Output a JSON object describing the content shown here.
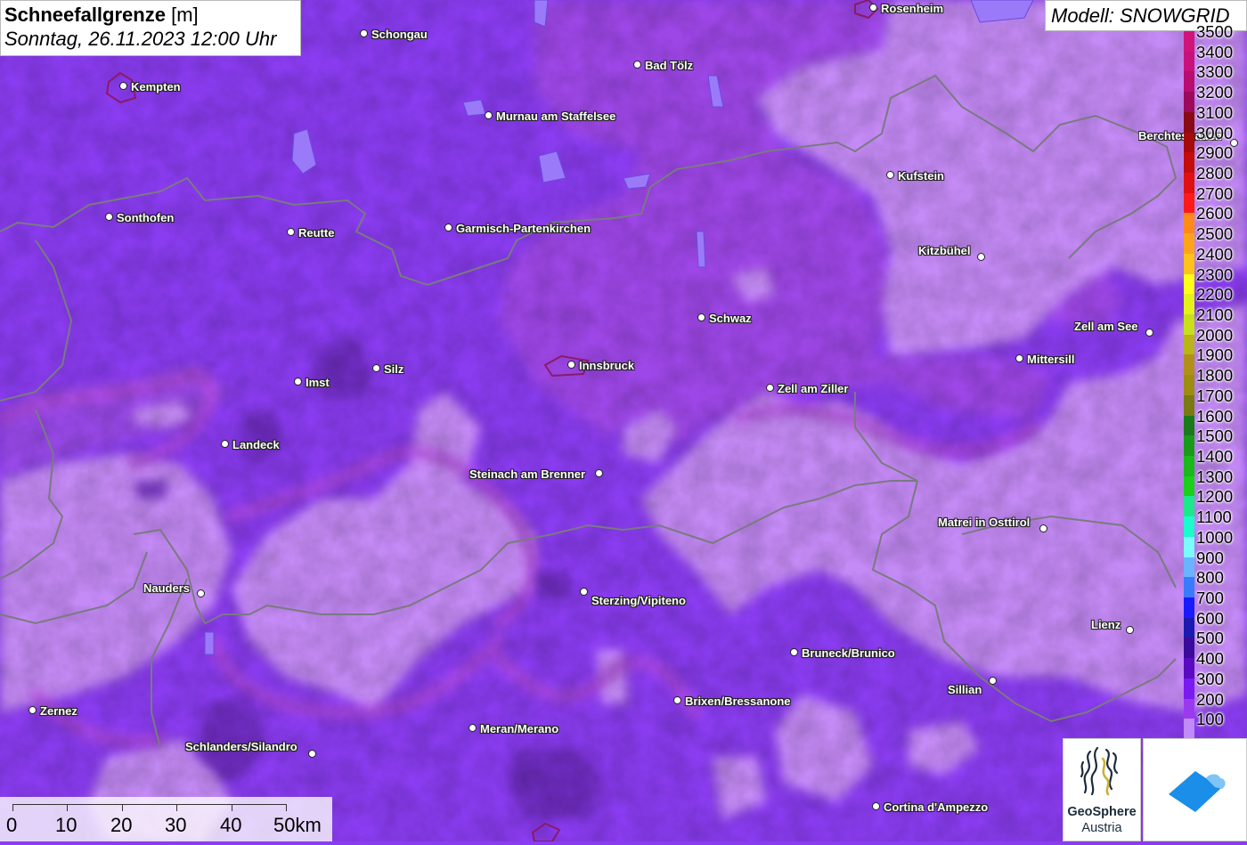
{
  "title": {
    "variable": "Schneefallgrenze",
    "unit": "[m]",
    "datetime": "Sonntag, 26.11.2023 12:00 Uhr"
  },
  "model": {
    "label": "Modell: SNOWGRID"
  },
  "legend": {
    "items": [
      {
        "label": "3500",
        "color": "#d1147a"
      },
      {
        "label": "3400",
        "color": "#c8117a"
      },
      {
        "label": "3300",
        "color": "#b80c6e"
      },
      {
        "label": "3200",
        "color": "#9c0a5c"
      },
      {
        "label": "3100",
        "color": "#8a0a14"
      },
      {
        "label": "3000",
        "color": "#a60a0a"
      },
      {
        "label": "2900",
        "color": "#c40c0c"
      },
      {
        "label": "2800",
        "color": "#e01010"
      },
      {
        "label": "2700",
        "color": "#ff1a1a"
      },
      {
        "label": "2600",
        "color": "#ff8a1a"
      },
      {
        "label": "2500",
        "color": "#ffa41a"
      },
      {
        "label": "2400",
        "color": "#ffc21a"
      },
      {
        "label": "2300",
        "color": "#ffff1a"
      },
      {
        "label": "2200",
        "color": "#e4f21a"
      },
      {
        "label": "2100",
        "color": "#c8e01a"
      },
      {
        "label": "2000",
        "color": "#b8b41a"
      },
      {
        "label": "1900",
        "color": "#b0901a"
      },
      {
        "label": "1800",
        "color": "#9c8c12"
      },
      {
        "label": "1700",
        "color": "#7a7a12"
      },
      {
        "label": "1600",
        "color": "#1a7a1a"
      },
      {
        "label": "1500",
        "color": "#1a9a1a"
      },
      {
        "label": "1400",
        "color": "#1ab81a"
      },
      {
        "label": "1300",
        "color": "#1ad01a"
      },
      {
        "label": "1200",
        "color": "#1ae88a"
      },
      {
        "label": "1100",
        "color": "#1afccc"
      },
      {
        "label": "1000",
        "color": "#7afcfc"
      },
      {
        "label": "900",
        "color": "#6ab4ff"
      },
      {
        "label": "800",
        "color": "#3a7aff"
      },
      {
        "label": "700",
        "color": "#1a1aff"
      },
      {
        "label": "600",
        "color": "#1a1ab0"
      },
      {
        "label": "500",
        "color": "#3a0a9a"
      },
      {
        "label": "400",
        "color": "#5a0ac0"
      },
      {
        "label": "300",
        "color": "#7a1af0"
      },
      {
        "label": "200",
        "color": "#9a3af0"
      },
      {
        "label": "100",
        "color": "#c08af8"
      }
    ]
  },
  "cities": [
    {
      "name": "Rosenheim"
    },
    {
      "name": "Schongau"
    },
    {
      "name": "Bad Tölz"
    },
    {
      "name": "Kempten"
    },
    {
      "name": "Murnau am Staffelsee"
    },
    {
      "name": "Berchtesgaden"
    },
    {
      "name": "Kufstein"
    },
    {
      "name": "Sonthofen"
    },
    {
      "name": "Reutte"
    },
    {
      "name": "Garmisch-Partenkirchen"
    },
    {
      "name": "Kitzbühel"
    },
    {
      "name": "Schwaz"
    },
    {
      "name": "Zell am See"
    },
    {
      "name": "Mittersill"
    },
    {
      "name": "Silz"
    },
    {
      "name": "Innsbruck"
    },
    {
      "name": "Imst"
    },
    {
      "name": "Zell am Ziller"
    },
    {
      "name": "Landeck"
    },
    {
      "name": "Steinach am Brenner"
    },
    {
      "name": "Matrei in Osttirol"
    },
    {
      "name": "Nauders"
    },
    {
      "name": "Sterzing/Vipiteno"
    },
    {
      "name": "Lienz"
    },
    {
      "name": "Bruneck/Brunico"
    },
    {
      "name": "Sillian"
    },
    {
      "name": "Brixen/Bressanone"
    },
    {
      "name": "Zernez"
    },
    {
      "name": "Meran/Merano"
    },
    {
      "name": "Schlanders/Silandro"
    },
    {
      "name": "Cortina d'Ampezzo"
    }
  ],
  "scale": {
    "labels": [
      "0",
      "10",
      "20",
      "30",
      "40",
      "50km"
    ]
  },
  "logos": {
    "geosphere_name": "GeoSphere",
    "geosphere_sub": "Austria"
  },
  "colors": {
    "light_lavender": "#c48af5",
    "purple": "#8a3cf0",
    "magenta_purple": "#a64ae6",
    "dark_purple": "#6a2ab8",
    "border_gray": "#7a7a80"
  }
}
